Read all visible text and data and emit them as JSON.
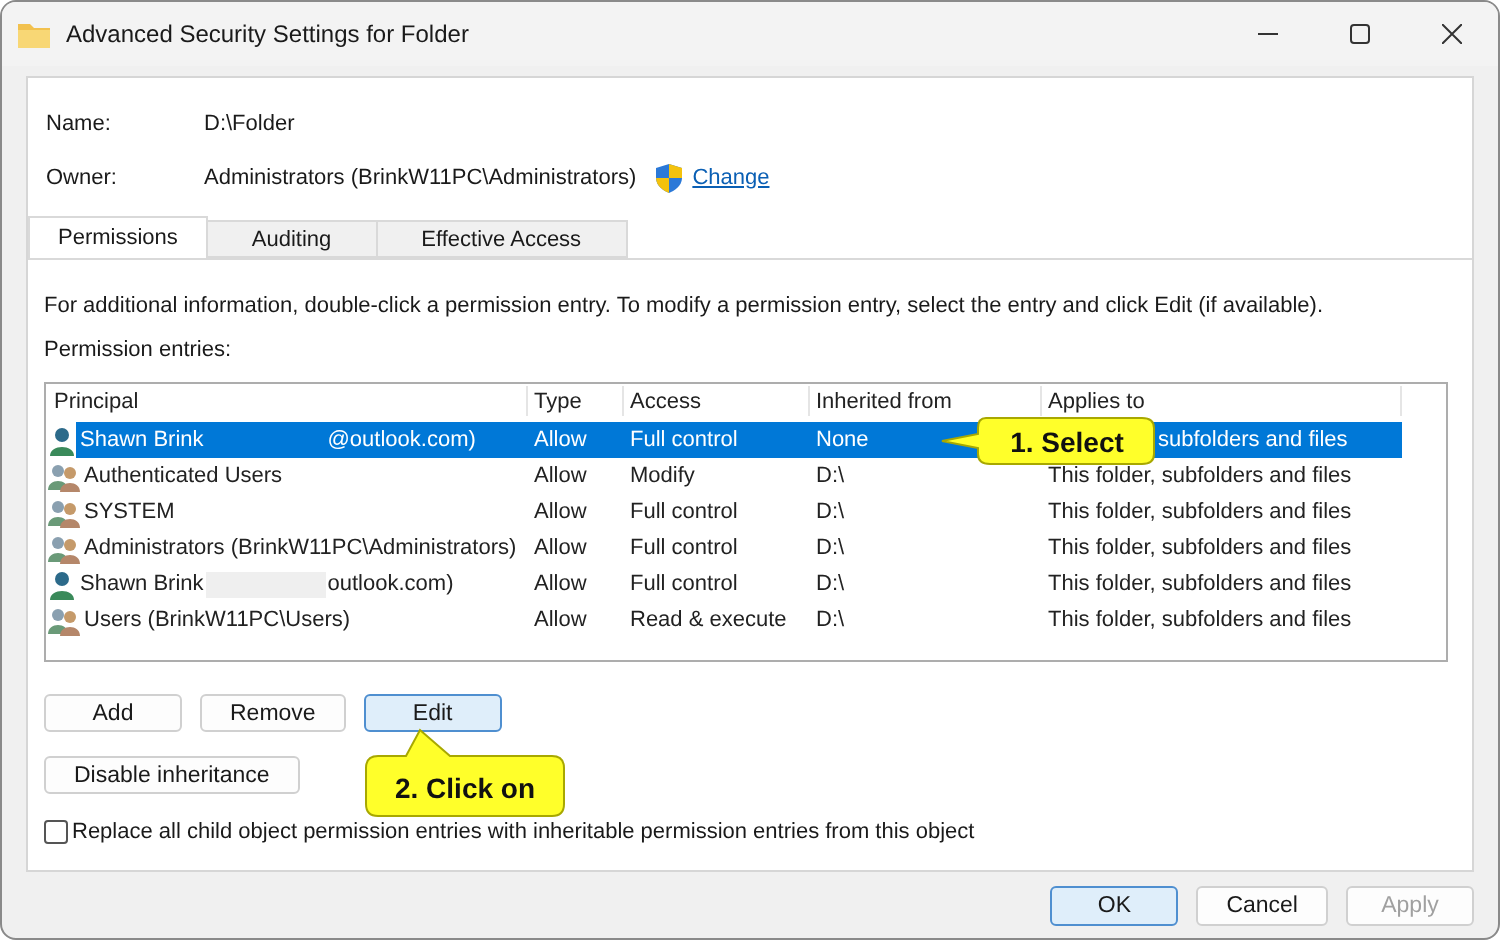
{
  "window": {
    "title": "Advanced Security Settings for Folder"
  },
  "name": {
    "label": "Name:",
    "value": "D:\\Folder"
  },
  "owner": {
    "label": "Owner:",
    "value": "Administrators (BrinkW11PC\\Administrators)",
    "link": "Change"
  },
  "tabs": [
    {
      "label": "Permissions",
      "selected": true
    },
    {
      "label": "Auditing",
      "selected": false
    },
    {
      "label": "Effective Access",
      "selected": false
    }
  ],
  "info": "For additional information, double-click a permission entry. To modify a permission entry, select the entry and click Edit (if available).",
  "entries_label": "Permission entries:",
  "table": {
    "columns": [
      "Principal",
      "Type",
      "Access",
      "Inherited from",
      "Applies to"
    ],
    "rows": [
      {
        "kind": "user",
        "principal": [
          "Shawn Brink",
          "@outlook.com)"
        ],
        "type": "Allow",
        "access": "Full control",
        "inherited": "None",
        "applies": "subfolders and files",
        "partly_hidden": true,
        "selected": true
      },
      {
        "kind": "group",
        "principal": [
          "Authenticated Users"
        ],
        "type": "Allow",
        "access": "Modify",
        "inherited": "D:\\",
        "applies": "This folder, subfolders and files",
        "selected": false
      },
      {
        "kind": "group",
        "principal": [
          "SYSTEM"
        ],
        "type": "Allow",
        "access": "Full control",
        "inherited": "D:\\",
        "applies": "This folder, subfolders and files",
        "selected": false
      },
      {
        "kind": "group",
        "principal": [
          "Administrators (BrinkW11PC\\Administrators)"
        ],
        "type": "Allow",
        "access": "Full control",
        "inherited": "D:\\",
        "applies": "This folder, subfolders and files",
        "selected": false
      },
      {
        "kind": "user",
        "principal": [
          "Shawn Brink",
          "outlook.com)"
        ],
        "type": "Allow",
        "access": "Full control",
        "inherited": "D:\\",
        "applies": "This folder, subfolders and files",
        "selected": false
      },
      {
        "kind": "group",
        "principal": [
          "Users (BrinkW11PC\\Users)"
        ],
        "type": "Allow",
        "access": "Read & execute",
        "inherited": "D:\\",
        "applies": "This folder, subfolders and files",
        "selected": false
      }
    ]
  },
  "entry_buttons": [
    {
      "label": "Add",
      "focused": false
    },
    {
      "label": "Remove",
      "focused": false
    },
    {
      "label": "Edit",
      "focused": true
    }
  ],
  "inheritance_button": "Disable inheritance",
  "replace_checkbox": {
    "label": "Replace all child object permission entries with inheritable permission entries from this object",
    "checked": false
  },
  "dialog_buttons": [
    {
      "label": "OK",
      "kind": "default",
      "disabled": false
    },
    {
      "label": "Cancel",
      "kind": "normal",
      "disabled": false
    },
    {
      "label": "Apply",
      "kind": "normal",
      "disabled": true
    }
  ],
  "callouts": [
    {
      "text": "1. Select",
      "kind": "pointing-left"
    },
    {
      "text": "2. Click on",
      "kind": "pointing-up"
    }
  ]
}
